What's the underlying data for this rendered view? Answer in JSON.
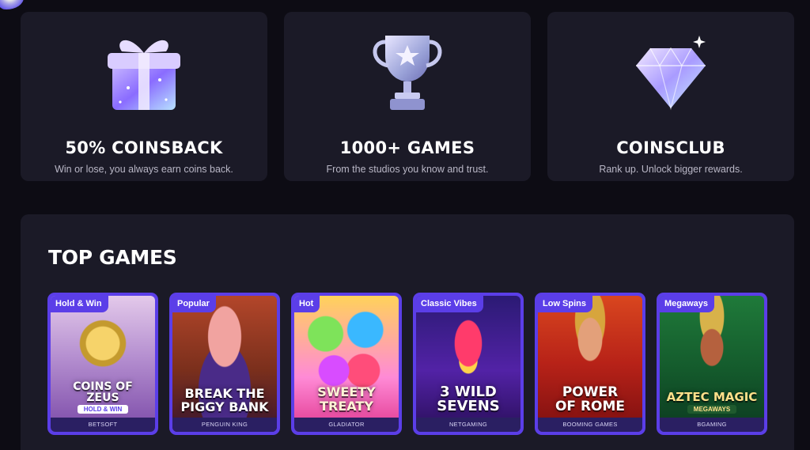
{
  "features": [
    {
      "title": "50% COINSBACK",
      "desc": "Win or lose, you always earn coins back.",
      "icon": "gift-box-icon"
    },
    {
      "title": "1000+ GAMES",
      "desc": "From the studios you know and trust.",
      "icon": "trophy-icon"
    },
    {
      "title": "COINSCLUB",
      "desc": "Rank up. Unlock bigger rewards.",
      "icon": "diamond-icon"
    }
  ],
  "top_games": {
    "title": "TOP GAMES",
    "games": [
      {
        "tag": "Hold & Win",
        "name": "COINS OF\nZEUS",
        "sub": "HOLD & WIN",
        "provider": "BETSOFT"
      },
      {
        "tag": "Popular",
        "name": "BREAK THE\nPIGGY BANK",
        "sub": "",
        "provider": "PENGUIN KING"
      },
      {
        "tag": "Hot",
        "name": "SWEETY\nTREATY",
        "sub": "",
        "provider": "GLADIATOR"
      },
      {
        "tag": "Classic Vibes",
        "name": "3 WILD\nSEVENS",
        "sub": "",
        "provider": "NETGAMING"
      },
      {
        "tag": "Low Spins",
        "name": "POWER\nOF ROME",
        "sub": "",
        "provider": "BOOMING GAMES"
      },
      {
        "tag": "Megaways",
        "name": "AZTEC MAGIC",
        "sub": "MEGAWAYS",
        "provider": "BGAMING"
      }
    ]
  },
  "colors": {
    "accent": "#5b3ee8",
    "card_bg": "#1b1a27",
    "page_bg": "#0d0c14"
  }
}
